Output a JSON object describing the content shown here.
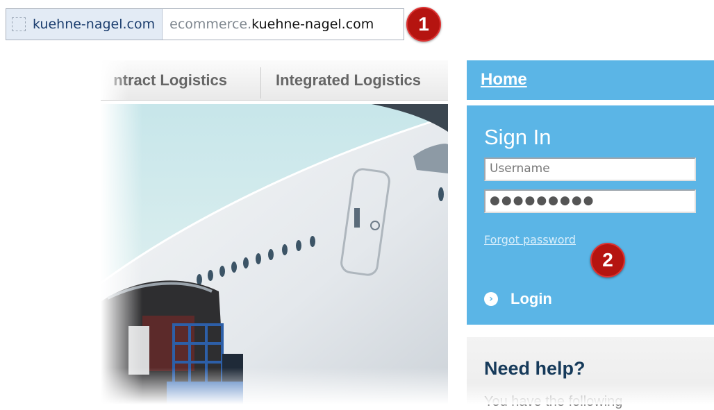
{
  "address_bar": {
    "site_identity": "kuehne-nagel.com",
    "url_prefix": "ecommerce.",
    "url_host": "kuehne-nagel.com"
  },
  "badges": {
    "first": "1",
    "second": "2"
  },
  "nav": {
    "tabs": [
      {
        "label": "ntract Logistics"
      },
      {
        "label": "Integrated Logistics"
      }
    ]
  },
  "sidebar": {
    "home_label": "Home",
    "signin": {
      "title": "Sign In",
      "username_placeholder": "Username",
      "password_value": "●●●●●●●●●",
      "forgot_label": "Forgot password",
      "login_label": "Login",
      "login_icon": "chevron-right-circle-icon"
    },
    "help": {
      "title": "Need help?",
      "text": "You have the following"
    }
  },
  "colors": {
    "accent": "#5bb5e6",
    "badge": "#b51410",
    "help_title": "#163a5a"
  }
}
